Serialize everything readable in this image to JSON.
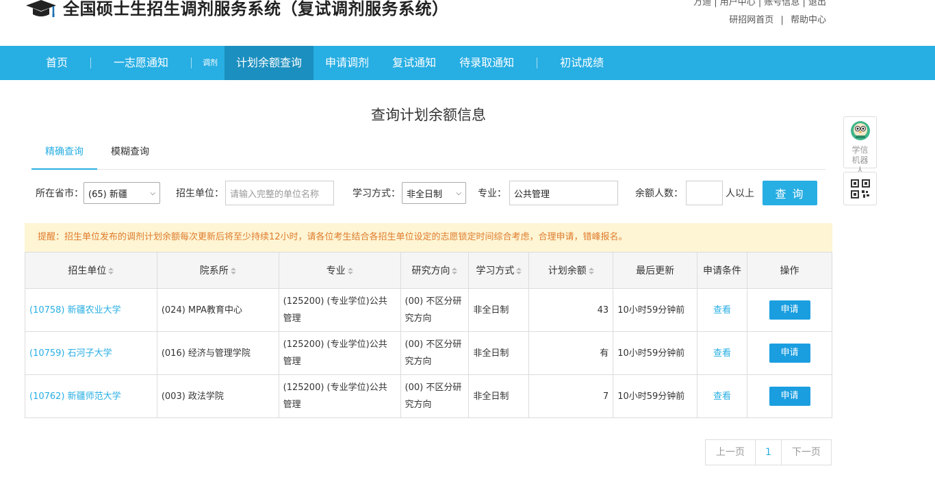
{
  "header": {
    "site_title": "全国硕士生招生调剂服务系统（复试调剂服务系统）",
    "top_row1": "万迪 | 用户中心 | 账号信息 | 退出",
    "links": [
      "研招网首页",
      "帮助中心"
    ],
    "link_separator": "|"
  },
  "nav": {
    "items": [
      "首页",
      "一志愿通知"
    ],
    "small_label": "调剂",
    "active": "计划余额查询",
    "items2": [
      "申请调剂",
      "复试通知",
      "待录取通知"
    ],
    "last": "初试成绩",
    "accent_color": "#27aee3",
    "active_color": "#1b8fbf"
  },
  "page_title": "查询计划余额信息",
  "tabs": [
    "精确查询",
    "模糊查询"
  ],
  "filters": {
    "province_label": "所在省市：",
    "province_value": "(65) 新疆",
    "unit_label": "招生单位：",
    "unit_placeholder": "请输入完整的单位名称",
    "mode_label": "学习方式：",
    "mode_value": "非全日制",
    "major_label": "专业：",
    "major_value": "公共管理",
    "remain_label": "余额人数：",
    "remain_value": "",
    "remain_suffix": "人以上",
    "query_button": "查 询"
  },
  "notice": "提醒：招生单位发布的调剂计划余额每次更新后将至少持续12小时，请各位考生结合各招生单位设定的志愿锁定时间综合考虑，合理申请，错峰报名。",
  "table": {
    "headers": [
      "招生单位",
      "院系所",
      "专业",
      "研究方向",
      "学习方式",
      "计划余额",
      "最后更新",
      "申请条件",
      "操作"
    ],
    "rows": [
      {
        "unit": "(10758) 新疆农业大学",
        "dept": "(024) MPA教育中心",
        "major": "(125200) (专业学位)公共管理",
        "direction": "(00) 不区分研究方向",
        "mode": "非全日制",
        "remain": "43",
        "updated": "10小时59分钟前",
        "cond": "查看",
        "op": "申请"
      },
      {
        "unit": "(10759) 石河子大学",
        "dept": "(016) 经济与管理学院",
        "major": "(125200) (专业学位)公共管理",
        "direction": "(00) 不区分研究方向",
        "mode": "非全日制",
        "remain": "有",
        "updated": "10小时59分钟前",
        "cond": "查看",
        "op": "申请"
      },
      {
        "unit": "(10762) 新疆师范大学",
        "dept": "(003) 政法学院",
        "major": "(125200) (专业学位)公共管理",
        "direction": "(00) 不区分研究方向",
        "mode": "非全日制",
        "remain": "7",
        "updated": "10小时59分钟前",
        "cond": "查看",
        "op": "申请"
      }
    ]
  },
  "pager": {
    "prev": "上一页",
    "current": "1",
    "next": "下一页"
  },
  "float": {
    "robot_label": "学信机器人",
    "robot_icon": "robot-icon",
    "qr_icon": "qr-code-icon"
  }
}
